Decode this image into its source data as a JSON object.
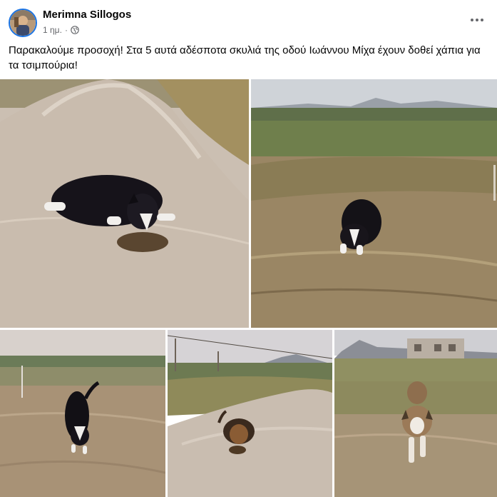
{
  "post": {
    "author": "Merimna Sillogos",
    "time": "1 ημ.",
    "separator": "·",
    "audience_icon": "globe-icon",
    "text": "Παρακαλούμε προσοχή! Στα 5 αυτά αδέσποτα σκυλιά της οδού Ιωάννου Μίχα έχουν δοθεί χάπια για τα τσιμπούρια!"
  },
  "photos": [
    {
      "subject": "black-and-white dog lying beside a sand pile"
    },
    {
      "subject": "black-and-white dog lying in a dry field"
    },
    {
      "subject": "black dog walking on a dirt lot"
    },
    {
      "subject": "brown-and-black dog lying on a sand mound"
    },
    {
      "subject": "tan dog walking in a field near an unfinished building"
    }
  ]
}
